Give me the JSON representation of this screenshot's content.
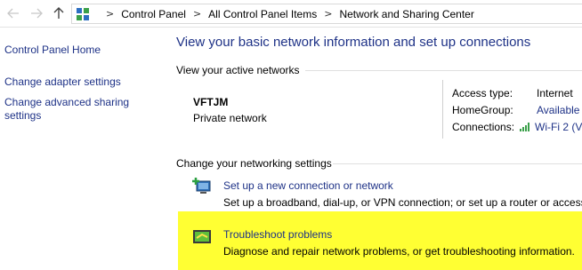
{
  "address_bar": {
    "breadcrumbs": [
      "Control Panel",
      "All Control Panel Items",
      "Network and Sharing Center"
    ]
  },
  "left_pane": {
    "links": [
      "Control Panel Home",
      "Change adapter settings",
      "Change advanced sharing settings"
    ]
  },
  "main": {
    "title": "View your basic network information and set up connections",
    "active_networks_heading": "View your active networks",
    "network": {
      "name": "VFTJM",
      "type": "Private network",
      "access_type_label": "Access type:",
      "access_type_value": "Internet",
      "homegroup_label": "HomeGroup:",
      "homegroup_value": "Available",
      "connections_label": "Connections:",
      "connections_value": "Wi-Fi 2 (V"
    },
    "settings_heading": "Change your networking settings",
    "tasks": [
      {
        "link": "Set up a new connection or network",
        "description": "Set up a broadband, dial-up, or VPN connection; or set up a router or access"
      },
      {
        "link": "Troubleshoot problems",
        "description": "Diagnose and repair network problems, or get troubleshooting information."
      }
    ]
  },
  "colors": {
    "link": "#1e3287",
    "highlight": "#ffff33"
  },
  "icons": [
    "back-arrow-icon",
    "forward-arrow-icon",
    "up-arrow-icon",
    "control-panel-icon",
    "wifi-signal-icon",
    "new-connection-icon",
    "troubleshoot-icon"
  ]
}
